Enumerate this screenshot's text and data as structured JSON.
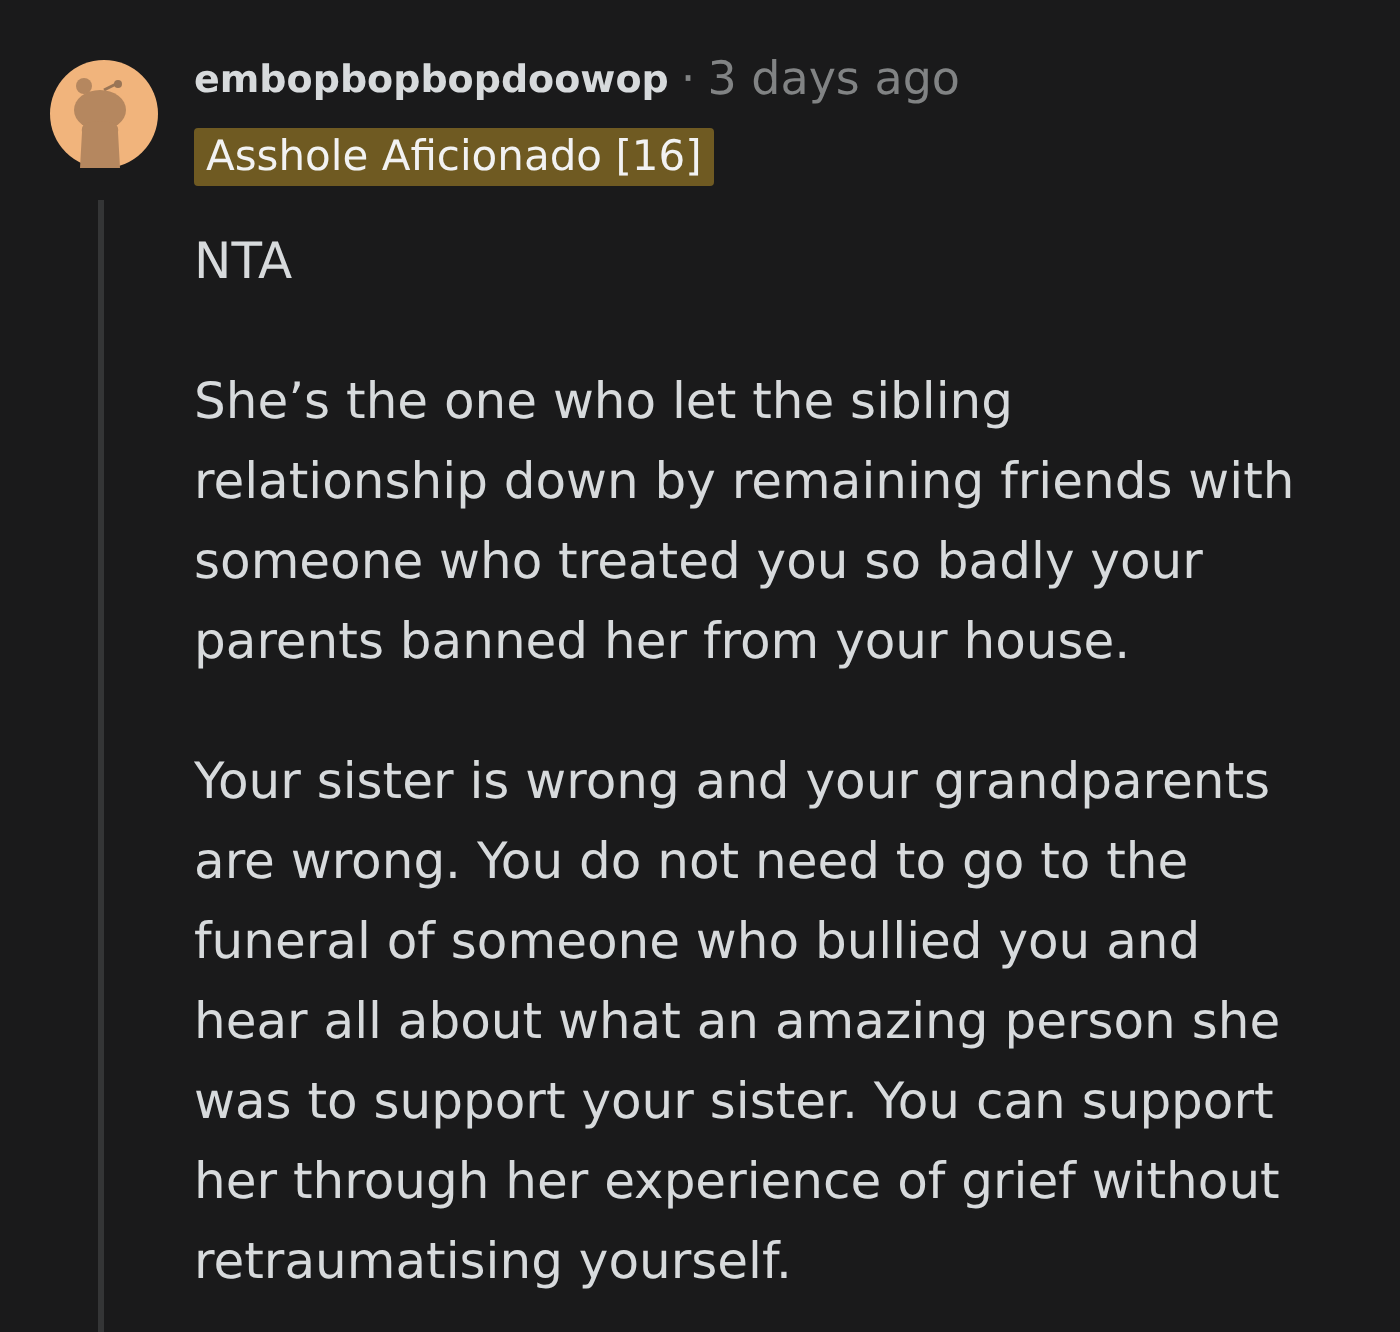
{
  "comment": {
    "author": "embopbopbopdoowop",
    "separator": "·",
    "time": "3 days ago",
    "flair": "Asshole Aficionado [16]",
    "paragraphs": [
      "NTA",
      "She’s the one who let the sibling relationship down by remaining friends with someone who treated you so badly your parents banned her from your house.",
      "Your sister is wrong and your grandparents are wrong. You do not need to go to the funeral of someone who bullied you and hear all about what an amazing person she was to support your sister. You can support her through her experience of grief without retraumatising yourself."
    ]
  }
}
